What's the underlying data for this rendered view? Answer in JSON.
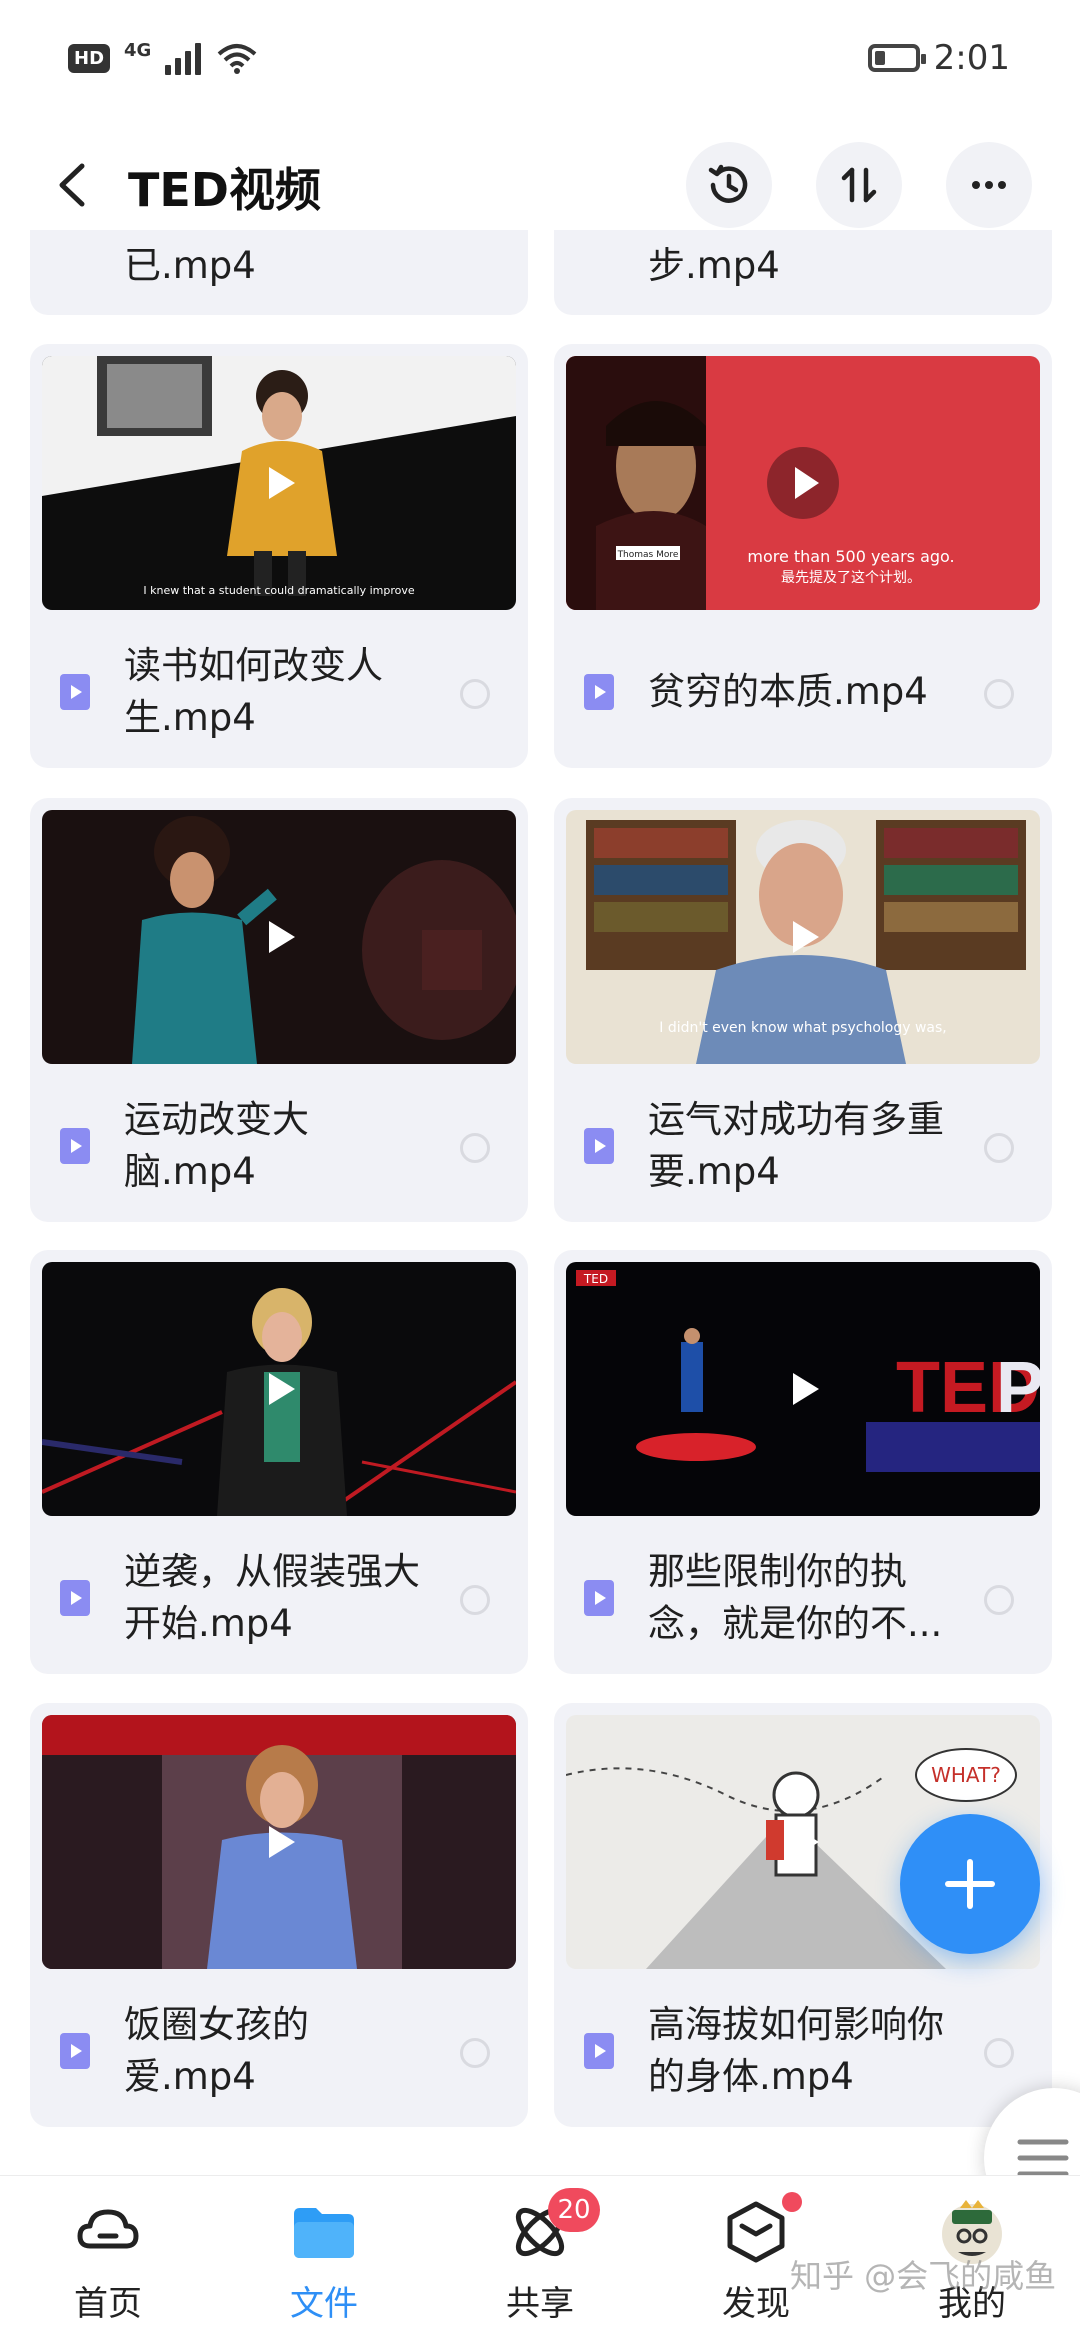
{
  "status_bar": {
    "hd": "HD",
    "network": "4G",
    "time": "2:01"
  },
  "header": {
    "title": "TED视频"
  },
  "cards_partial": [
    {
      "name": "已.mp4"
    },
    {
      "name": "步.mp4"
    }
  ],
  "files": [
    {
      "name": "读书如何改变人生.mp4",
      "subtitle": "I knew that a student could dramatically improve"
    },
    {
      "name": "贫穷的本质.mp4",
      "caption_top": "more than 500 years ago.",
      "caption_cn": "最先提及了这个计划。",
      "tag": "Thomas More"
    },
    {
      "name": "运动改变大脑.mp4"
    },
    {
      "name": "运气对成功有多重要.mp4",
      "subtitle": "I didn't even know what psychology was,"
    },
    {
      "name": "逆袭，从假装强大开始.mp4"
    },
    {
      "name": "那些限制你的执念，就是你的不...",
      "tag": "TED"
    },
    {
      "name": "饭圈女孩的爱.mp4"
    },
    {
      "name": "高海拔如何影响你的身体.mp4",
      "bubble": "WHAT?"
    }
  ],
  "bottom_nav": [
    {
      "label": "首页",
      "icon": "home-cloud-icon",
      "active": false
    },
    {
      "label": "文件",
      "icon": "folder-icon",
      "active": true
    },
    {
      "label": "共享",
      "icon": "share-atom-icon",
      "badge": "20",
      "active": false
    },
    {
      "label": "发现",
      "icon": "discover-cube-icon",
      "dot": true,
      "active": false
    },
    {
      "label": "我的",
      "icon": "avatar-icon",
      "active": false
    }
  ],
  "watermark": "知乎 @会飞的咸鱼",
  "colors": {
    "accent": "#2e8ff6",
    "card_bg": "#f1f2f7",
    "badge": "#f04a5d",
    "file_icon": "#8b8cf2"
  }
}
